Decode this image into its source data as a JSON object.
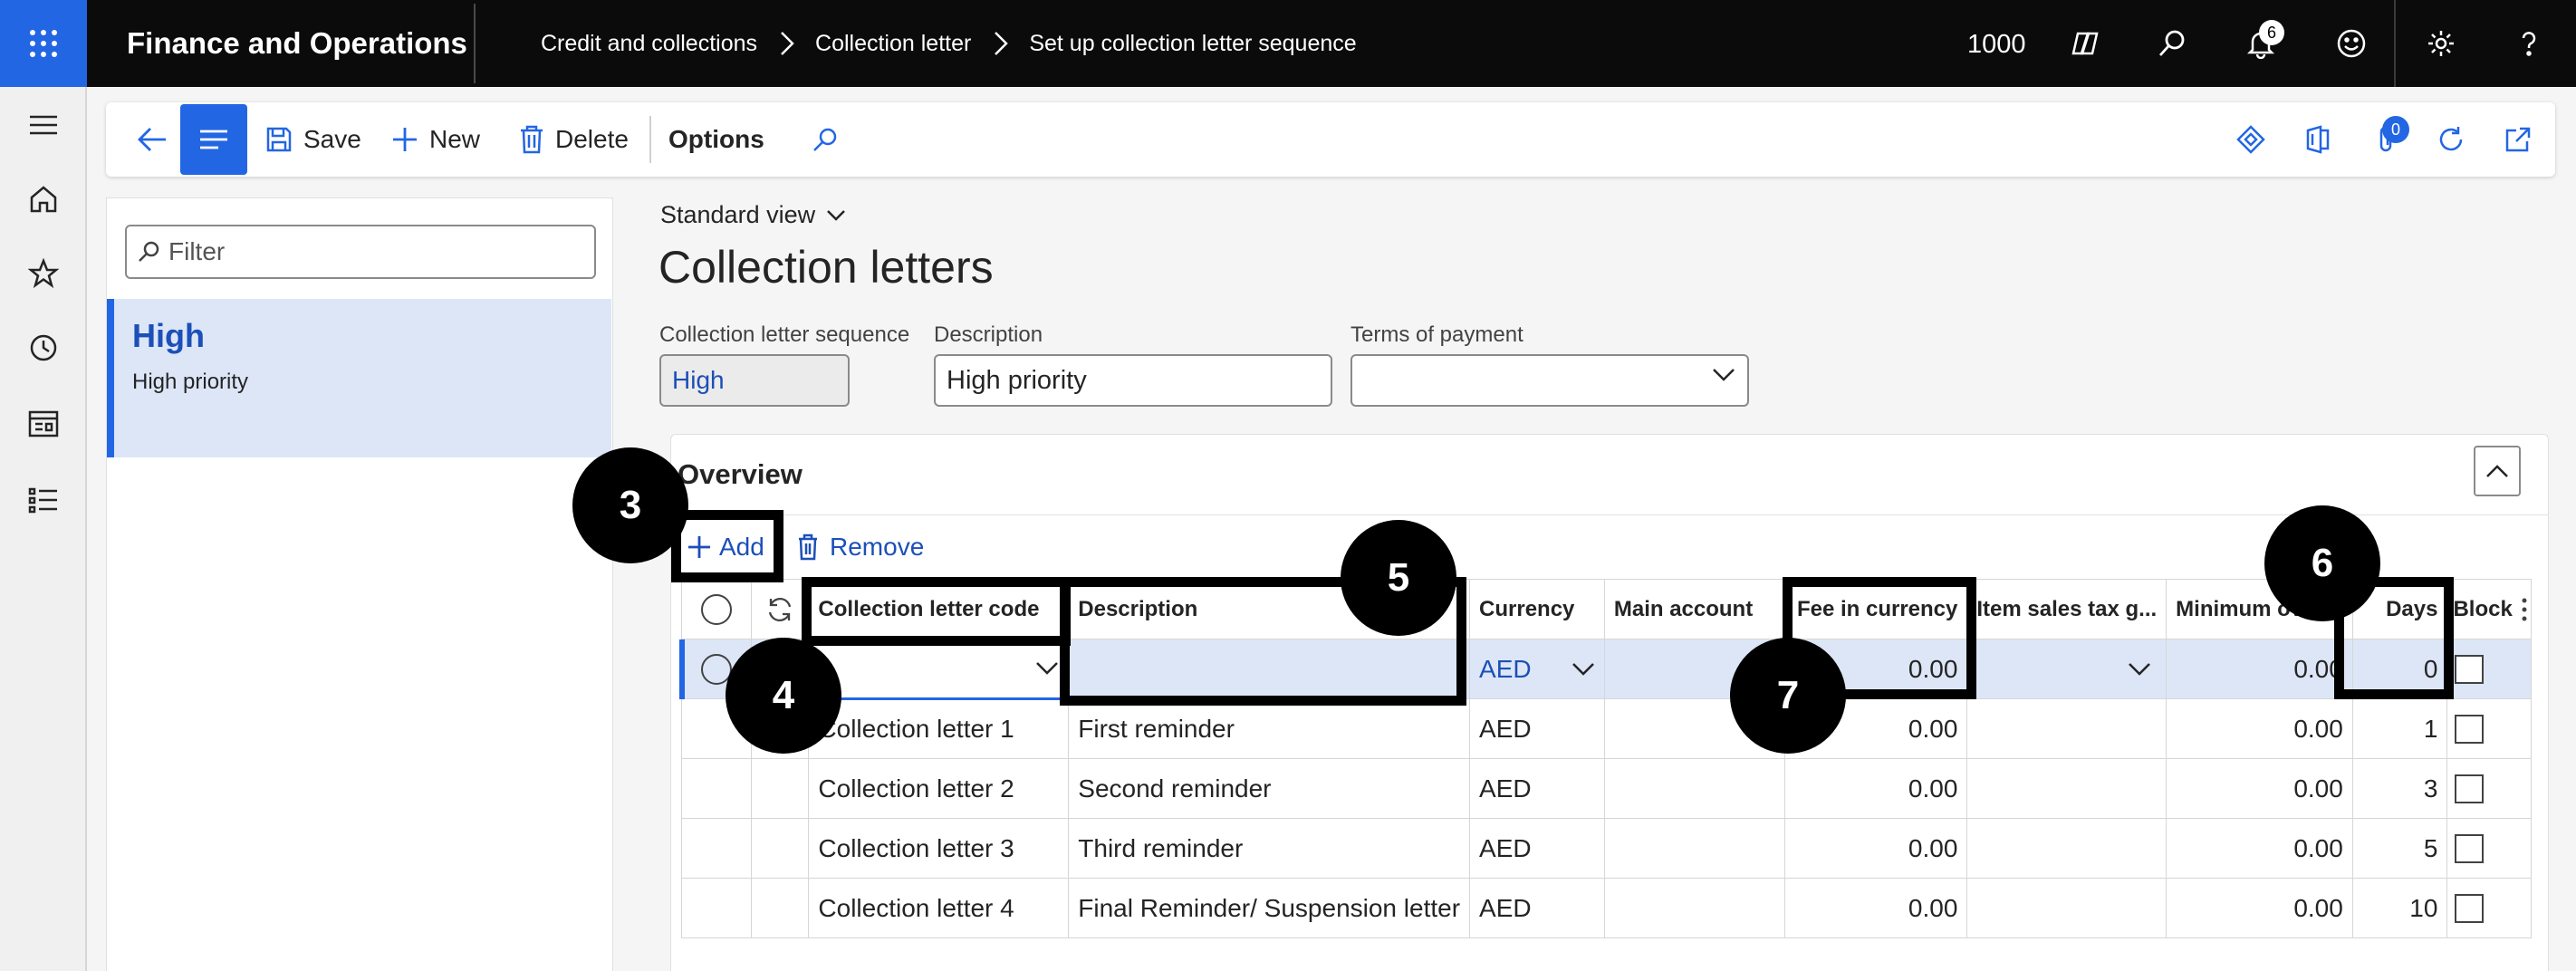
{
  "topbar": {
    "app_name": "Finance and Operations",
    "breadcrumbs": [
      "Credit and collections",
      "Collection letter",
      "Set up collection letter sequence"
    ],
    "company": "1000",
    "notifications_count": "6"
  },
  "actionbar": {
    "save": "Save",
    "new": "New",
    "delete": "Delete",
    "options": "Options",
    "attachments_count": "0"
  },
  "listpane": {
    "filter_placeholder": "Filter",
    "item_title": "High",
    "item_subtitle": "High priority"
  },
  "header": {
    "view_name": "Standard view",
    "page_title": "Collection letters",
    "fields": {
      "sequence_label": "Collection letter sequence",
      "sequence_value": "High",
      "description_label": "Description",
      "description_value": "High priority",
      "terms_label": "Terms of payment",
      "terms_value": ""
    }
  },
  "overview": {
    "title": "Overview",
    "add": "Add",
    "remove": "Remove",
    "columns": {
      "code": "Collection letter code",
      "description": "Description",
      "currency": "Currency",
      "main_account": "Main account",
      "fee": "Fee in currency",
      "item_tax": "Item sales tax g...",
      "minimum": "Minimum ov",
      "days": "Days",
      "block": "Block"
    },
    "new_row": {
      "code": "",
      "description": "",
      "currency": "AED",
      "main_account": "",
      "fee": "0.00",
      "item_tax": "",
      "minimum": "0.00",
      "days": "0"
    },
    "rows": [
      {
        "code": "Collection letter 1",
        "description": "First reminder",
        "currency": "AED",
        "main_account": "",
        "fee": "0.00",
        "item_tax": "",
        "minimum": "0.00",
        "days": "1"
      },
      {
        "code": "Collection letter 2",
        "description": "Second reminder",
        "currency": "AED",
        "main_account": "",
        "fee": "0.00",
        "item_tax": "",
        "minimum": "0.00",
        "days": "3"
      },
      {
        "code": "Collection letter 3",
        "description": "Third reminder",
        "currency": "AED",
        "main_account": "",
        "fee": "0.00",
        "item_tax": "",
        "minimum": "0.00",
        "days": "5"
      },
      {
        "code": "Collection letter 4",
        "description": "Final Reminder/ Suspension letter",
        "currency": "AED",
        "main_account": "",
        "fee": "0.00",
        "item_tax": "",
        "minimum": "0.00",
        "days": "10"
      }
    ]
  },
  "callouts": {
    "c3": "3",
    "c4": "4",
    "c5": "5",
    "c6": "6",
    "c7": "7"
  },
  "colors": {
    "accent": "#2266e3",
    "topbar": "#0b0b0b",
    "selection": "#dce6f7"
  }
}
